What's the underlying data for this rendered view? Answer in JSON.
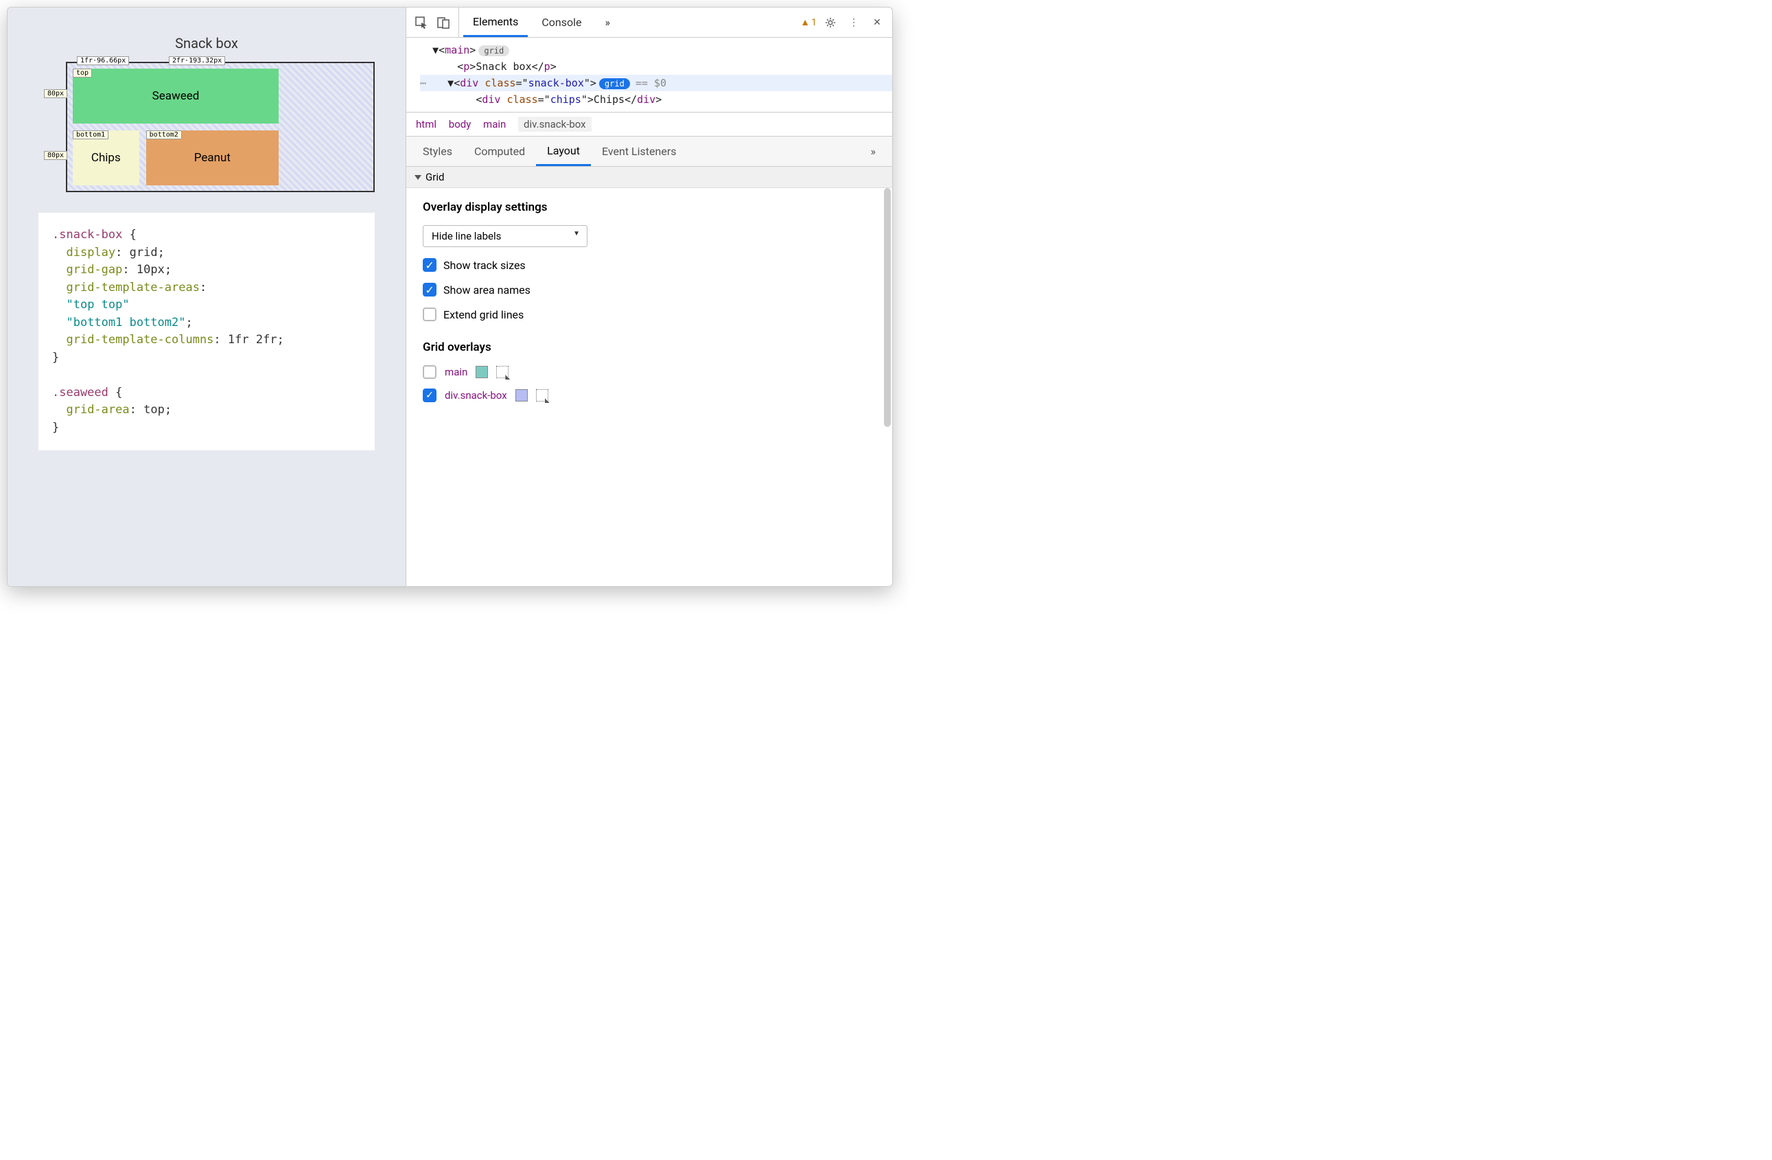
{
  "preview": {
    "title": "Snack box",
    "columns": [
      "1fr·96.66px",
      "2fr·193.32px"
    ],
    "rows": [
      "80px",
      "80px"
    ],
    "cells": {
      "seaweed": {
        "label": "Seaweed",
        "area": "top"
      },
      "chips": {
        "label": "Chips",
        "area": "bottom1"
      },
      "peanut": {
        "label": "Peanut",
        "area": "bottom2"
      }
    },
    "code": {
      "selector1": ".snack-box",
      "props1": [
        {
          "p": "display",
          "v": "grid"
        },
        {
          "p": "grid-gap",
          "v": "10px"
        },
        {
          "p": "grid-template-areas",
          "v": ""
        }
      ],
      "area1": "\"top top\"",
      "area2": "\"bottom1 bottom2\"",
      "gtc_p": "grid-template-columns",
      "gtc_v": "1fr 2fr",
      "selector2": ".seaweed",
      "props2": [
        {
          "p": "grid-area",
          "v": "top"
        }
      ]
    }
  },
  "devtools": {
    "tabs": {
      "elements": "Elements",
      "console": "Console",
      "more": "»"
    },
    "warning_count": "1",
    "dom": {
      "line1_tag": "main",
      "line1_badge": "grid",
      "line2_tag": "p",
      "line2_text": "Snack box",
      "line3_tag": "div",
      "line3_attr": "class",
      "line3_val": "snack-box",
      "line3_badge": "grid",
      "line3_ref": "== $0",
      "line4_tag": "div",
      "line4_attr": "class",
      "line4_val": "chips",
      "line4_text": "Chips"
    },
    "breadcrumb": [
      "html",
      "body",
      "main",
      "div.snack-box"
    ],
    "subtabs": {
      "styles": "Styles",
      "computed": "Computed",
      "layout": "Layout",
      "listeners": "Event Listeners",
      "more": "»"
    },
    "layout": {
      "section": "Grid",
      "overlay_settings_title": "Overlay display settings",
      "line_labels_select": "Hide line labels",
      "show_track_sizes": "Show track sizes",
      "show_area_names": "Show area names",
      "extend_grid_lines": "Extend grid lines",
      "grid_overlays_title": "Grid overlays",
      "overlays": [
        {
          "name": "main",
          "checked": false,
          "color": "#7ecac0"
        },
        {
          "name": "div.snack-box",
          "checked": true,
          "color": "#b6bdf2"
        }
      ]
    }
  }
}
